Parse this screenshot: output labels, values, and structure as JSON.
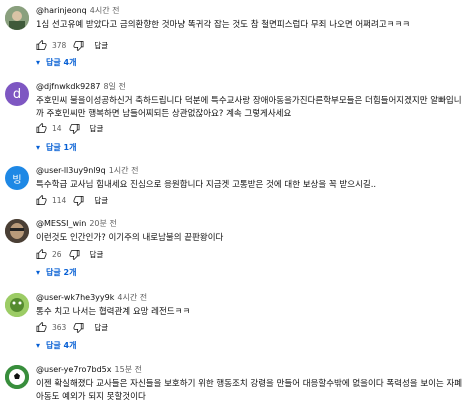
{
  "comments": [
    {
      "handle": "@harinjeonq",
      "time": "4시간 전",
      "text": "1심 선고유예 받았다고 금의환향한 것마냥 똑귀각 잡는 것도 참 철면피스럽다 무죄 나오면 어쩌려고ㅋㅋㅋ",
      "likes": "378",
      "reply_label": "답글",
      "replies_label": "답글 4개",
      "avatar_icon": "photo-avatar",
      "avatar_color": "#6f8f6a"
    },
    {
      "handle": "@djfnwkdk9287",
      "time": "8일 전",
      "text": "주호민씨 불을이성공하신거 축하드립니다 덕분에 특수교사랑 장애아동을가진다른학부모들은 더힘들어지겠지만 알빠입니\n까 주호민씨만 행복하면 남들어찌되든 상관없잖아요? 계속 그렇게사세요",
      "likes": "14",
      "reply_label": "답글",
      "replies_label": "답글 1개",
      "avatar_letter": "d",
      "avatar_color": "#7e57c2"
    },
    {
      "handle": "@user-ll3uy9nl9q",
      "time": "1시간 전",
      "text": "특수학급 교사님 힘내세요 진심으로 응원합니다 지금겟 고통받은 것에 대한 보상을 꼭 받으시길..",
      "likes": "114",
      "reply_label": "답글",
      "avatar_letter": "빙",
      "avatar_color": "#1e88e5"
    },
    {
      "handle": "@MESSI_win",
      "time": "20분 전",
      "text": "이런것도 인간인가? 이기주의 내로남불의 끝판왕이다",
      "likes": "26",
      "reply_label": "답글",
      "replies_label": "답글 2개",
      "avatar_icon": "photo-avatar",
      "avatar_color": "#5a4a3a"
    },
    {
      "handle": "@user-wk7he3yy9k",
      "time": "4시간 전",
      "text": "통수 치고 나서는 협력관계 요망 레전드ㅋㅋ",
      "likes": "363",
      "reply_label": "답글",
      "replies_label": "답글 4개",
      "avatar_icon": "photo-avatar",
      "avatar_color": "#7cb342"
    },
    {
      "handle": "@user-ye7ro7bd5x",
      "time": "15분 전",
      "text": "이젠 확실해졌다 교사들은 자신들을 보호하기 위한 행동조치 강령을 만들어 대응할수밖에 없을이다 폭력성을 보이는 자폐\n아동도 예외가 되지 못할것이다",
      "avatar_icon": "soccer-ball-avatar",
      "avatar_color": "#2e7d32"
    }
  ],
  "colors": {
    "link_blue": "#065fd4",
    "meta_gray": "#606060"
  }
}
